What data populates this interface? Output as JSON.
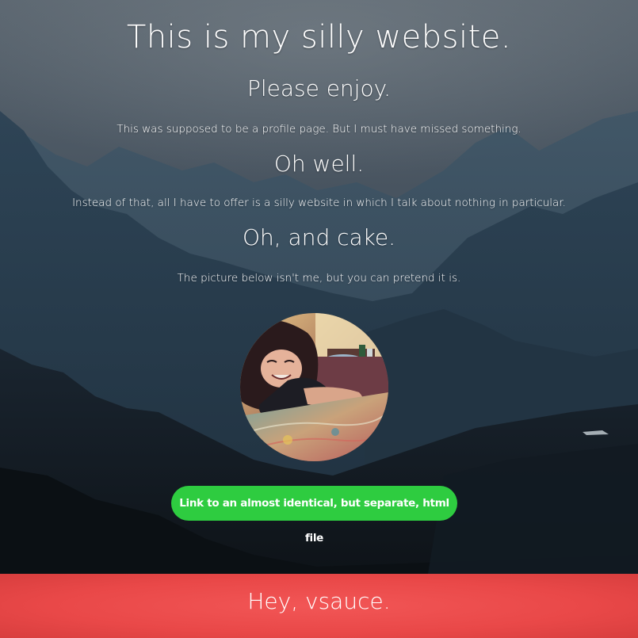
{
  "header": {
    "title": "This is my silly website.",
    "subtitle": "Please enjoy."
  },
  "body": {
    "line1": "This was supposed to be a profile page. But I must have missed something.",
    "heading2": "Oh well.",
    "line2": "Instead of that, all I have to offer is a silly website in which I talk about nothing in particular.",
    "heading3": "Oh, and cake.",
    "line3": "The picture below isn't me, but you can pretend it is."
  },
  "link_button": {
    "label": "Link to an almost identical, but separate, html file",
    "color": "#2ecc40"
  },
  "footer": {
    "text": "Hey, vsauce.",
    "color": "#f25656"
  },
  "icons": {
    "avatar": "profile-photo"
  }
}
